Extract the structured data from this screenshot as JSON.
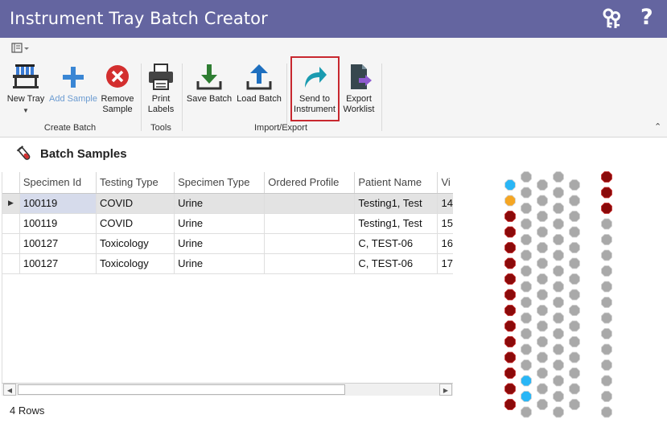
{
  "window": {
    "title": "Instrument Tray Batch Creator"
  },
  "ribbon": {
    "new_tray": "New Tray",
    "add_sample": "Add Sample",
    "remove_sample_1": "Remove",
    "remove_sample_2": "Sample",
    "print_labels_1": "Print",
    "print_labels_2": "Labels",
    "save_batch": "Save Batch",
    "load_batch": "Load Batch",
    "send_to_instrument_1": "Send to",
    "send_to_instrument_2": "Instrument",
    "export_worklist_1": "Export",
    "export_worklist_2": "Worklist",
    "groups": {
      "create_batch": "Create Batch",
      "tools": "Tools",
      "import_export": "Import/Export"
    }
  },
  "panel": {
    "title": "Batch Samples"
  },
  "grid": {
    "columns": [
      "Specimen Id",
      "Testing Type",
      "Specimen Type",
      "Ordered Profile",
      "Patient Name",
      "Vi"
    ],
    "rows": [
      [
        "100119",
        "COVID",
        "Urine",
        "",
        "Testing1, Test",
        "14"
      ],
      [
        "100119",
        "COVID",
        "Urine",
        "",
        "Testing1, Test",
        "15"
      ],
      [
        "100127",
        "Toxicology",
        "Urine",
        "",
        "C, TEST-06",
        "16"
      ],
      [
        "100127",
        "Toxicology",
        "Urine",
        "",
        "C, TEST-06",
        "17"
      ]
    ]
  },
  "status": {
    "row_count": "4 Rows"
  },
  "colors": {
    "titlebar": "#6465a0",
    "highlight": "#c8282f",
    "well_empty": "#a9a9a9",
    "well_filled": "#8b0a0a",
    "well_selected": "#29b6f6",
    "well_pending": "#f5a623"
  },
  "tray": {
    "columns": [
      {
        "wells": [
          "selected",
          "pending",
          "filled",
          "filled",
          "filled",
          "filled",
          "filled",
          "filled",
          "filled",
          "filled",
          "filled",
          "filled",
          "filled",
          "filled",
          "filled",
          "filled"
        ]
      },
      {
        "wells": [
          "empty",
          "empty",
          "empty",
          "empty",
          "empty",
          "empty",
          "empty",
          "empty",
          "empty",
          "empty",
          "empty",
          "empty",
          "empty",
          "selected",
          "selected",
          "empty"
        ]
      },
      {
        "wells": [
          "empty",
          "empty",
          "empty",
          "empty",
          "empty",
          "empty",
          "empty",
          "empty",
          "empty",
          "empty",
          "empty",
          "empty",
          "empty",
          "empty",
          "empty",
          "empty"
        ]
      },
      {
        "wells": [
          "empty",
          "empty",
          "empty",
          "empty",
          "empty",
          "empty",
          "empty",
          "empty",
          "empty",
          "empty",
          "empty",
          "empty",
          "empty",
          "empty",
          "empty",
          "empty"
        ]
      },
      {
        "wells": [
          "empty",
          "empty",
          "empty",
          "empty",
          "empty",
          "empty",
          "empty",
          "empty",
          "empty",
          "empty",
          "empty",
          "empty",
          "empty",
          "empty",
          "empty",
          "empty"
        ]
      },
      {
        "wells": [
          "filled",
          "filled",
          "filled",
          "empty",
          "empty",
          "empty",
          "empty",
          "empty",
          "empty",
          "empty",
          "empty",
          "empty",
          "empty",
          "empty",
          "empty",
          "empty"
        ]
      }
    ]
  }
}
